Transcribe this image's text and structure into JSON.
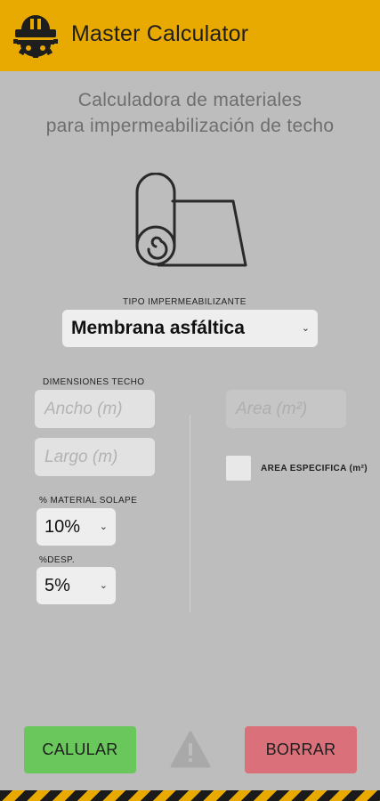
{
  "header": {
    "title": "Master Calculator",
    "logo_icon": "helmet-gear-icon",
    "background_color": "#e8a900"
  },
  "subtitle": {
    "line1": "Calculadora de materiales",
    "line2": "para impermeabilización de techo"
  },
  "illustration": {
    "icon": "membrane-roll-icon"
  },
  "waterproofing": {
    "label": "TIPO IMPERMEABILIZANTE",
    "selected": "Membrana asfáltica"
  },
  "dimensions": {
    "label": "DIMENSIONES TECHO",
    "width_placeholder": "Ancho (m)",
    "length_placeholder": "Largo (m)"
  },
  "area": {
    "placeholder": "Area (m²)",
    "checkbox_label": "AREA ESPECIFICA (m²)",
    "checked": false
  },
  "overlap": {
    "label": "% MATERIAL SOLAPE",
    "selected": "10%"
  },
  "waste": {
    "label": "%DESP.",
    "selected": "5%"
  },
  "actions": {
    "calculate_label": "CALULAR",
    "clear_label": "BORRAR",
    "warning_icon": "warning-icon",
    "calculate_color": "#6ac75c",
    "clear_color": "#d9707a"
  },
  "footer": {
    "pattern": "hazard-stripes"
  }
}
